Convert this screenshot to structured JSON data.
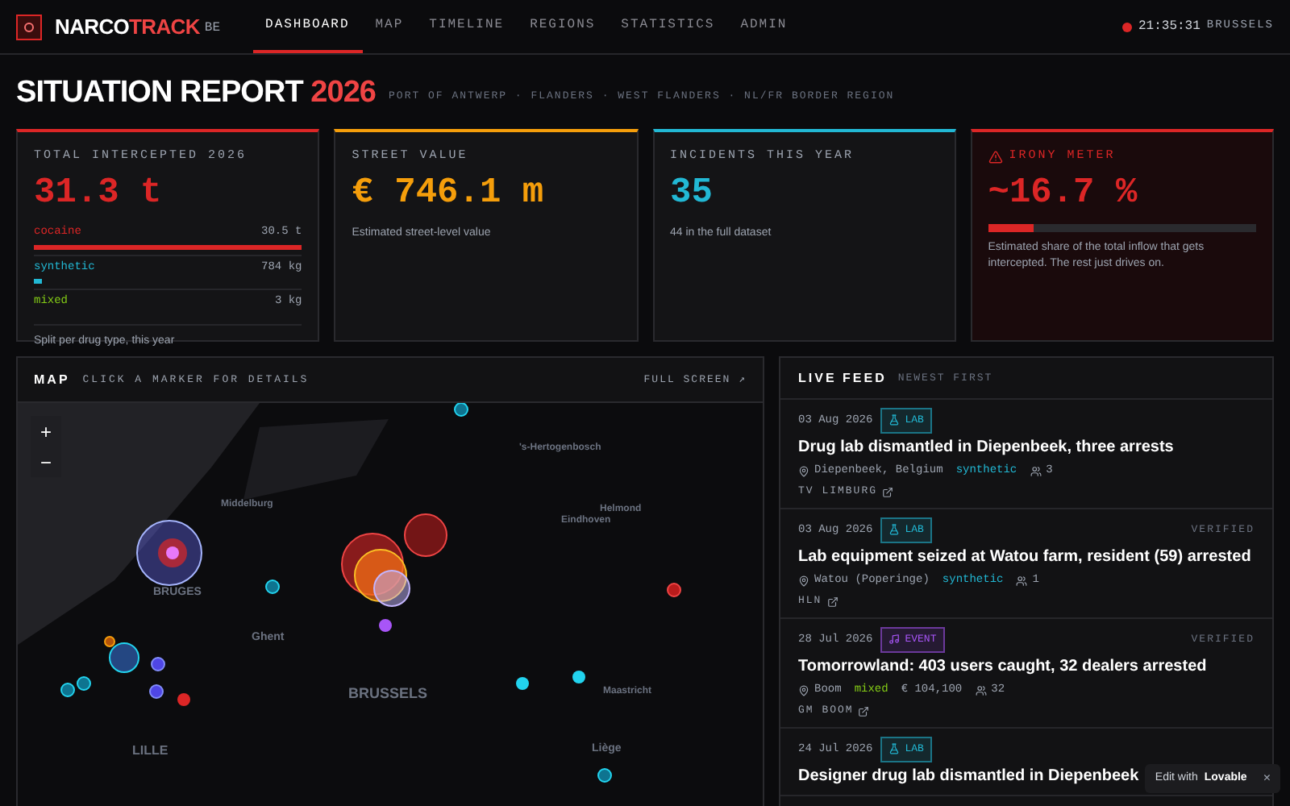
{
  "brand": {
    "name_part_1": "NARCO",
    "name_part_2": "TRACK",
    "suffix": "BE"
  },
  "nav": [
    {
      "label": "DASHBOARD",
      "selected": true
    },
    {
      "label": "MAP",
      "selected": false
    },
    {
      "label": "TIMELINE",
      "selected": false
    },
    {
      "label": "REGIONS",
      "selected": false
    },
    {
      "label": "STATISTICS",
      "selected": false
    },
    {
      "label": "ADMIN",
      "selected": false
    }
  ],
  "clock": {
    "time": "21:35:31",
    "city": "BRUSSELS",
    "live": true
  },
  "heading": {
    "title": "SITUATION REPORT",
    "year": "2026",
    "subtitle": "PORT OF ANTWERP · FLANDERS · WEST FLANDERS · NL/FR BORDER REGION"
  },
  "cards": [
    {
      "kind": "breakdown",
      "color": "#dc2626",
      "label": "TOTAL INTERCEPTED 2026",
      "value": "31.3 t",
      "note": "Split per drug type, this year",
      "rows": [
        {
          "name": "cocaine",
          "amount": "30.5 t",
          "level": 1.0,
          "color": "#dc2626"
        },
        {
          "name": "synthetic",
          "amount": "784 kg",
          "level": 0.03,
          "color": "#22b8d4"
        },
        {
          "name": "mixed",
          "amount": "3 kg",
          "color": "#84cc16"
        }
      ]
    },
    {
      "kind": "plain",
      "color": "#f59e0b",
      "label": "STREET VALUE",
      "value": "€ 746.1 m",
      "note": "Estimated street-level value"
    },
    {
      "kind": "plain",
      "color": "#22b8d4",
      "label": "INCIDENTS THIS YEAR",
      "value": "35",
      "note": "44 in the full dataset"
    },
    {
      "kind": "meter",
      "color": "#dc2626",
      "label": "IRONY METER",
      "value": "~16.7 %",
      "level": 0.167,
      "note": "Estimated share of the total inflow that gets intercepted. The rest just drives on."
    }
  ],
  "map": {
    "title": "MAP",
    "hint": "CLICK A MARKER FOR DETAILS",
    "fullscreen": "FULL SCREEN ↗",
    "zoom_in": "+",
    "zoom_out": "−",
    "places": [
      "'s-Hertogenbosch",
      "Middelburg",
      "Helmond",
      "Eindhoven",
      "BRUGES",
      "Ghent",
      "BRUSSELS",
      "Maastricht",
      "LILLE",
      "Liège"
    ]
  },
  "feed": {
    "title": "LIVE FEED",
    "hint": "NEWEST FIRST",
    "items": [
      {
        "date": "03 Aug 2026",
        "tag": {
          "kind": "lab",
          "label": "LAB"
        },
        "title": "Drug lab dismantled in Diepenbeek, three arrests",
        "location": "Diepenbeek, Belgium",
        "drug": {
          "name": "synthetic",
          "color": "#22b8d4"
        },
        "people": "3",
        "source": "TV LIMBURG"
      },
      {
        "date": "03 Aug 2026",
        "tag": {
          "kind": "lab",
          "label": "LAB"
        },
        "verified_label": "VERIFIED",
        "title": "Lab equipment seized at Watou farm, resident (59) arrested",
        "location": "Watou (Poperinge)",
        "drug": {
          "name": "synthetic",
          "color": "#22b8d4"
        },
        "people": "1",
        "source": "HLN"
      },
      {
        "date": "28 Jul 2026",
        "tag": {
          "kind": "event",
          "label": "EVENT"
        },
        "verified_label": "VERIFIED",
        "title": "Tomorrowland: 403 users caught, 32 dealers arrested",
        "location": "Boom",
        "drug": {
          "name": "mixed",
          "color": "#84cc16"
        },
        "value": "€ 104,100",
        "people": "32",
        "source": "GM BOOM"
      },
      {
        "date": "24 Jul 2026",
        "tag": {
          "kind": "lab",
          "label": "LAB"
        },
        "title": "Designer drug lab dismantled in Diepenbeek"
      }
    ]
  },
  "badge": {
    "prefix": "Edit with",
    "brand": "Lovable",
    "close": "×"
  }
}
